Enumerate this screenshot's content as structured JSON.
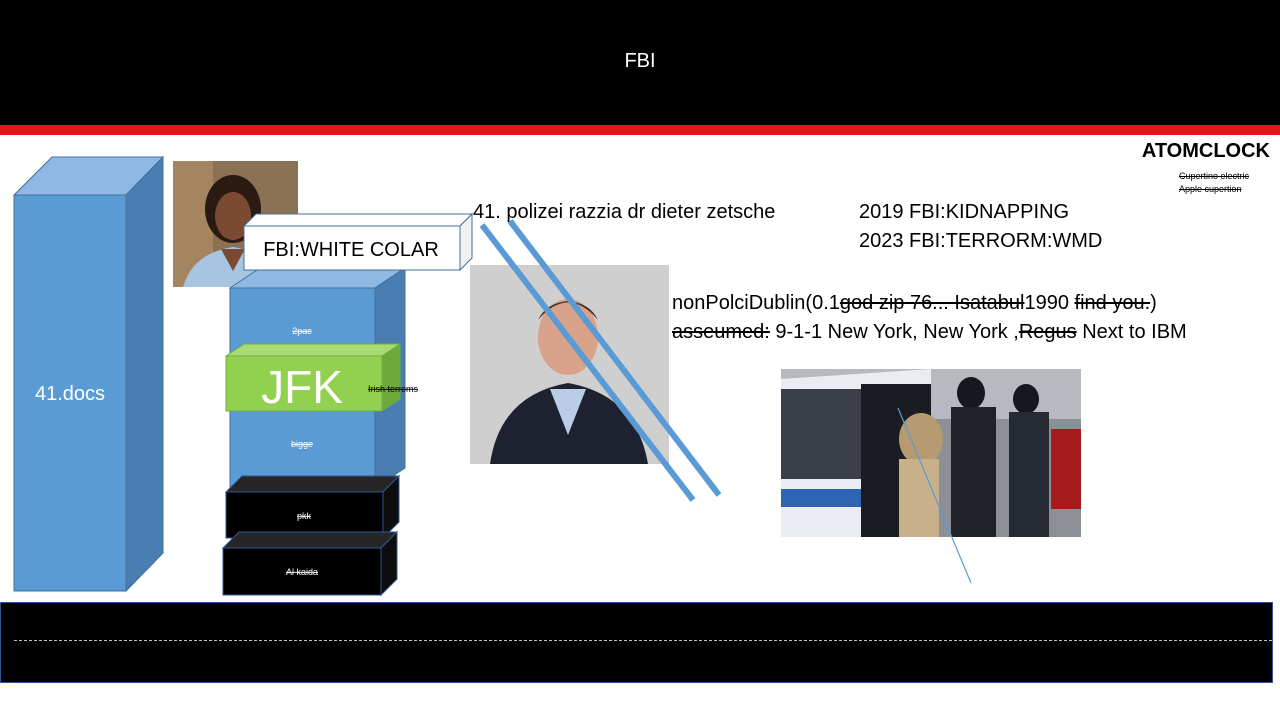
{
  "header": {
    "title": "FBI"
  },
  "clock": {
    "title": "ATOMCLOCK",
    "note_1": "Cupertino electric",
    "note_2": "Apple cupertion"
  },
  "big_box": {
    "label": "41.docs"
  },
  "stack": {
    "white_box": "FBI:WHITE COLAR",
    "block_1": "2pac",
    "jfk": "JFK",
    "jfk_side": "Irish terroms",
    "block_2": "bigge",
    "black_1": "pkk",
    "black_2": "Al kaida"
  },
  "headline": "41. polizei razzia dr dieter zetsche",
  "events": [
    "2019 FBI:KIDNAPPING",
    "2023 FBI:TERRORM:WMD"
  ],
  "line_1": {
    "a": "nonPolciDublin(0.1",
    "b": "god zip 76... Isatabul",
    "c": "1990",
    "d": "find you.",
    "e": ")"
  },
  "line_2": {
    "a": "asseumed:",
    "b": " 9-1-1 New York, New York ,",
    "c": "Regus",
    "d": " Next to IBM"
  },
  "colors": {
    "box_blue": "#5b9bd5",
    "jfk_green": "#92d050",
    "stripe_red": "#e8141c"
  }
}
